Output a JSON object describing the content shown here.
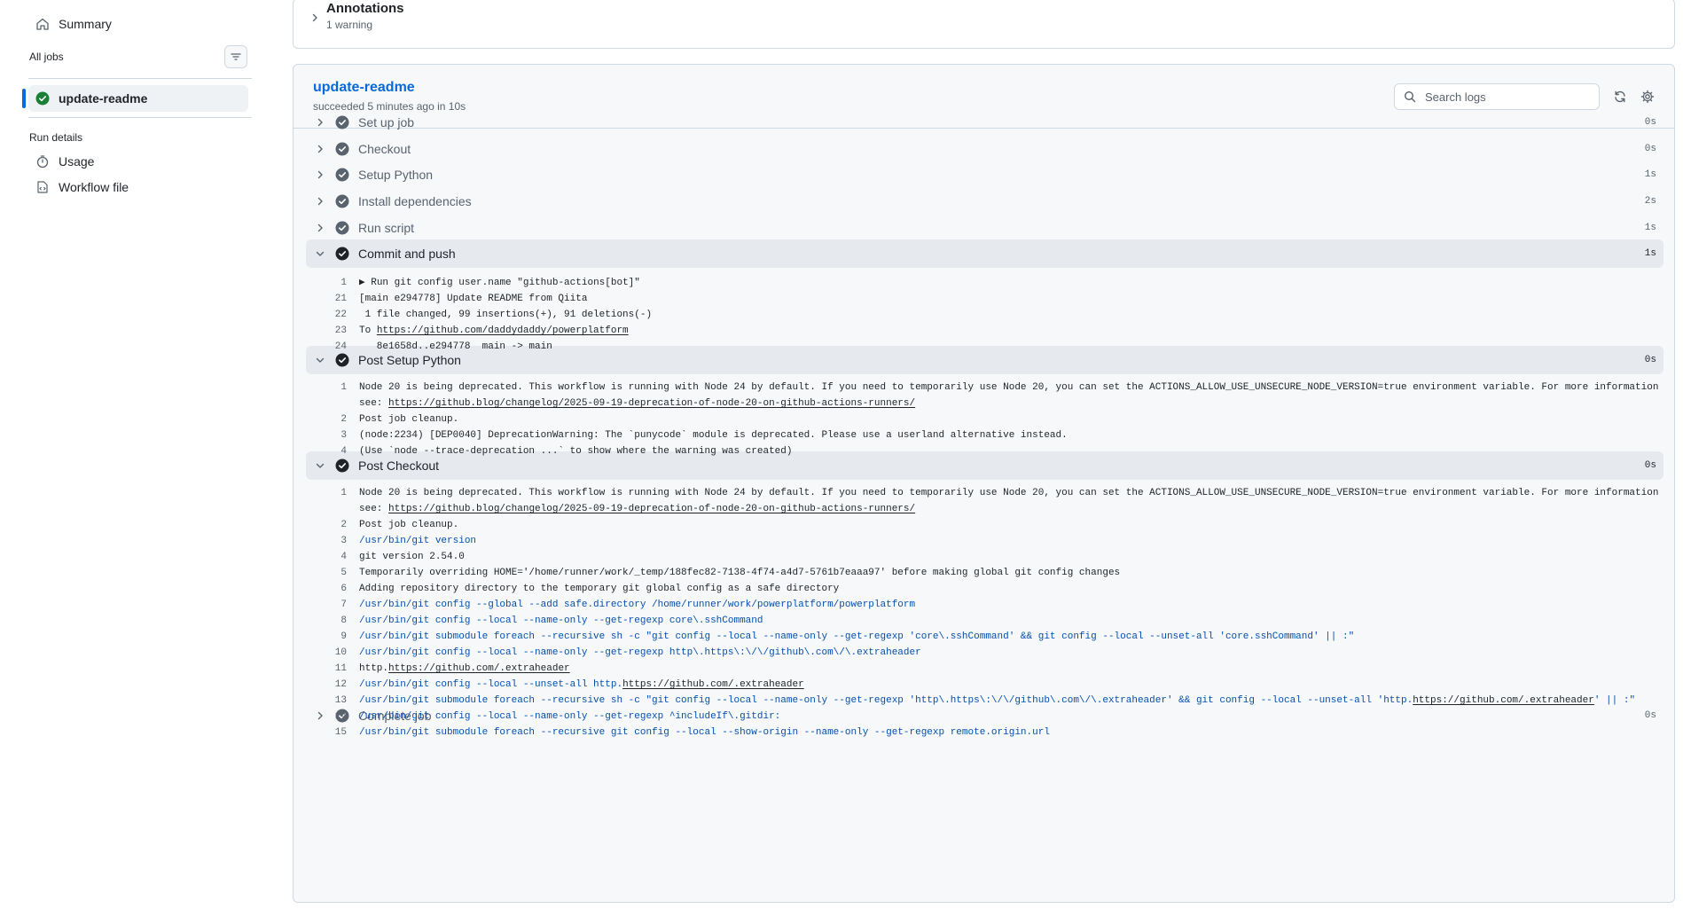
{
  "sidebar": {
    "summary": "Summary",
    "all_jobs": "All jobs",
    "job": "update-readme",
    "run_details": "Run details",
    "usage": "Usage",
    "workflow_file": "Workflow file"
  },
  "annotations": {
    "title": "Annotations",
    "subtitle": "1 warning"
  },
  "job": {
    "title": "update-readme",
    "subtitle": "succeeded 5 minutes ago in 10s",
    "search_placeholder": "Search logs"
  },
  "colors": {
    "accent": "#0969da",
    "success": "#1a7f37",
    "command": "#0550ae"
  },
  "steps": [
    {
      "name": "Set up job",
      "duration": "0s"
    },
    {
      "name": "Checkout",
      "duration": "0s"
    },
    {
      "name": "Setup Python",
      "duration": "1s"
    },
    {
      "name": "Install dependencies",
      "duration": "2s"
    },
    {
      "name": "Run script",
      "duration": "1s"
    },
    {
      "name": "Commit and push",
      "duration": "1s"
    },
    {
      "name": "Post Setup Python",
      "duration": "0s"
    },
    {
      "name": "Post Checkout",
      "duration": "0s"
    },
    {
      "name": "Complete job",
      "duration": "0s"
    }
  ],
  "logs": {
    "commit_push": [
      {
        "num": "1",
        "text": "▶ Run git config user.name \"github-actions[bot]\""
      },
      {
        "num": "21",
        "text": "[main e294778] Update README from Qiita"
      },
      {
        "num": "22",
        "text": " 1 file changed, 99 insertions(+), 91 deletions(-)"
      },
      {
        "num": "23",
        "pre": "To ",
        "link": "https://github.com/daddydaddy/powerplatform"
      },
      {
        "num": "24",
        "text": "   8e1658d..e294778  main -> main"
      }
    ],
    "post_setup_python": [
      {
        "num": "1",
        "text": "Node 20 is being deprecated. This workflow is running with Node 24 by default. If you need to temporarily use Node 20, you can set the ACTIONS_ALLOW_USE_UNSECURE_NODE_VERSION=true environment variable. For more information"
      },
      {
        "num": "",
        "pre": "see: ",
        "link": "https://github.blog/changelog/2025-09-19-deprecation-of-node-20-on-github-actions-runners/"
      },
      {
        "num": "2",
        "text": "Post job cleanup."
      },
      {
        "num": "3",
        "text": "(node:2234) [DEP0040] DeprecationWarning: The `punycode` module is deprecated. Please use a userland alternative instead."
      },
      {
        "num": "4",
        "text": "(Use `node --trace-deprecation ...` to show where the warning was created)"
      }
    ],
    "post_checkout": [
      {
        "num": "1",
        "text": "Node 20 is being deprecated. This workflow is running with Node 24 by default. If you need to temporarily use Node 20, you can set the ACTIONS_ALLOW_USE_UNSECURE_NODE_VERSION=true environment variable. For more information"
      },
      {
        "num": "",
        "pre": "see: ",
        "link": "https://github.blog/changelog/2025-09-19-deprecation-of-node-20-on-github-actions-runners/"
      },
      {
        "num": "2",
        "text": "Post job cleanup."
      },
      {
        "num": "3",
        "text": "/usr/bin/git version",
        "cmd": true
      },
      {
        "num": "4",
        "text": "git version 2.54.0"
      },
      {
        "num": "5",
        "text": "Temporarily overriding HOME='/home/runner/work/_temp/188fec82-7138-4f74-a4d7-5761b7eaaa97' before making global git config changes"
      },
      {
        "num": "6",
        "text": "Adding repository directory to the temporary git global config as a safe directory"
      },
      {
        "num": "7",
        "text": "/usr/bin/git config --global --add safe.directory /home/runner/work/powerplatform/powerplatform",
        "cmd": true
      },
      {
        "num": "8",
        "text": "/usr/bin/git config --local --name-only --get-regexp core\\.sshCommand",
        "cmd": true
      },
      {
        "num": "9",
        "text": "/usr/bin/git submodule foreach --recursive sh -c \"git config --local --name-only --get-regexp 'core\\.sshCommand' && git config --local --unset-all 'core.sshCommand' || :\"",
        "cmd": true
      },
      {
        "num": "10",
        "text": "/usr/bin/git config --local --name-only --get-regexp http\\.https\\:\\/\\/github\\.com\\/\\.extraheader",
        "cmd": true
      },
      {
        "num": "11",
        "pre": "http.",
        "link": "https://github.com/.extraheader"
      },
      {
        "num": "12",
        "pre": "/usr/bin/git config --local --unset-all http.",
        "link": "https://github.com/.extraheader",
        "cmd": true
      },
      {
        "num": "13",
        "pre": "/usr/bin/git submodule foreach --recursive sh -c \"git config --local --name-only --get-regexp 'http\\.https\\:\\/\\/github\\.com\\/\\.extraheader' && git config --local --unset-all 'http.",
        "link": "https://github.com/.extraheader",
        "post": "' || :\"",
        "cmd": true
      },
      {
        "num": "14",
        "text": "/usr/bin/git config --local --name-only --get-regexp ^includeIf\\.gitdir:",
        "cmd": true
      },
      {
        "num": "15",
        "text": "/usr/bin/git submodule foreach --recursive git config --local --show-origin --name-only --get-regexp remote.origin.url",
        "cmd": true
      }
    ]
  }
}
